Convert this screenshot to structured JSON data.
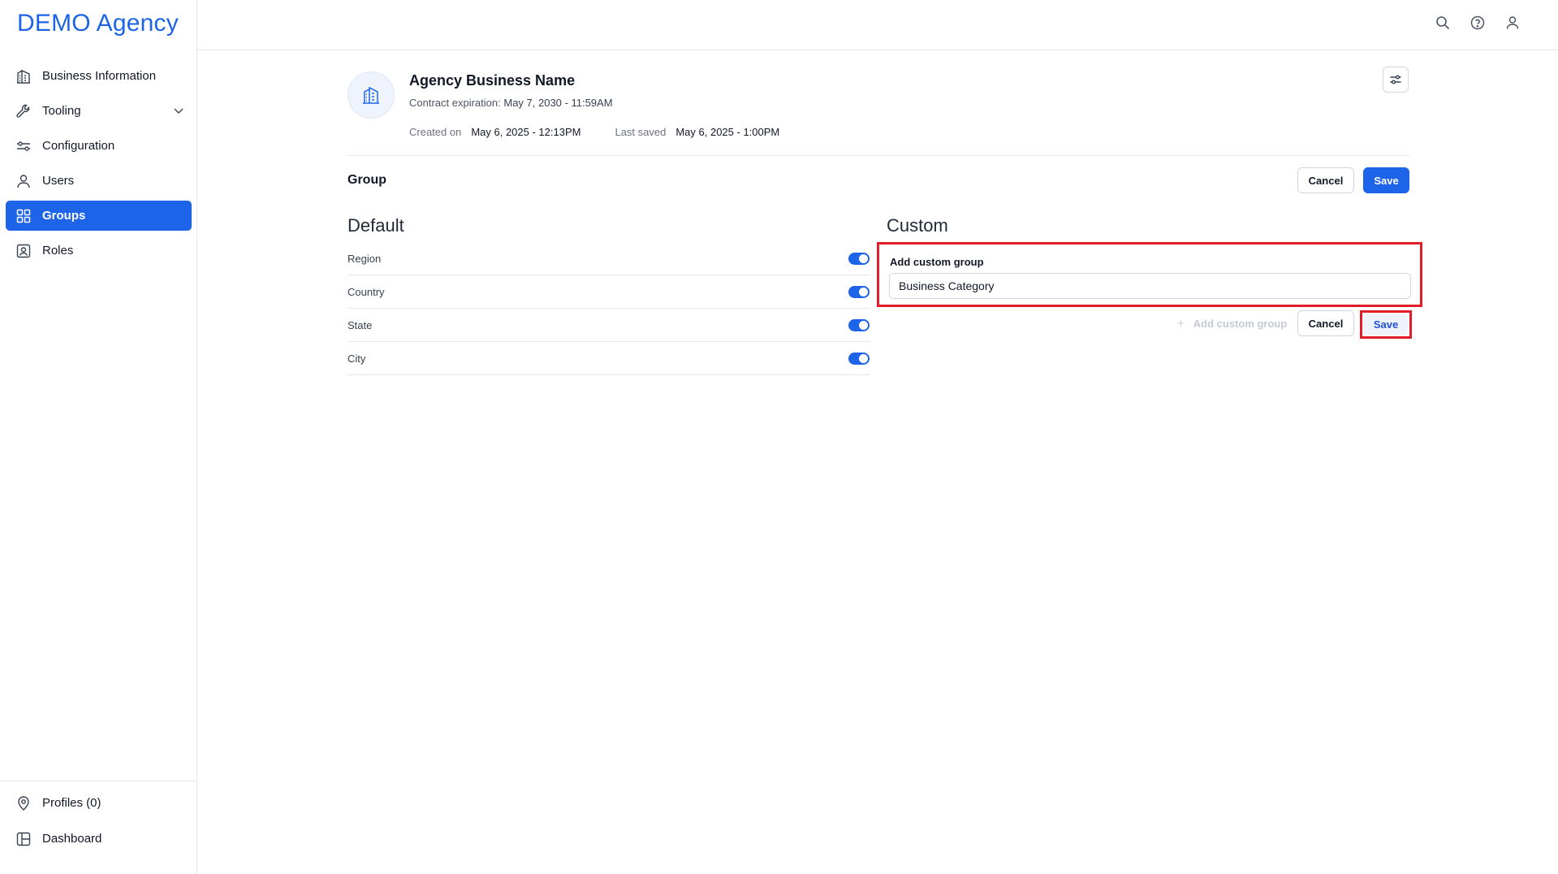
{
  "brand": "DEMO Agency",
  "sidebar": {
    "items": [
      {
        "label": "Business Information",
        "icon": "building-icon"
      },
      {
        "label": "Tooling",
        "icon": "wrench-icon"
      },
      {
        "label": "Configuration",
        "icon": "sliders-icon"
      },
      {
        "label": "Users",
        "icon": "user-icon"
      },
      {
        "label": "Groups",
        "icon": "grid-icon",
        "active": true
      },
      {
        "label": "Roles",
        "icon": "id-badge-icon"
      }
    ],
    "bottom_items": [
      {
        "label": "Profiles (0)",
        "icon": "location-pin-icon"
      },
      {
        "label": "Dashboard",
        "icon": "layout-icon"
      }
    ]
  },
  "agency": {
    "name": "Agency Business Name",
    "contract_label": "Contract expiration:",
    "contract_value": "May 7, 2030 - 11:59AM",
    "created_label": "Created on",
    "created_value": "May 6, 2025 - 12:13PM",
    "saved_label": "Last saved",
    "saved_value": "May 6, 2025 - 1:00PM"
  },
  "group": {
    "title": "Group",
    "cancel_label": "Cancel",
    "save_label": "Save"
  },
  "default_col": {
    "title": "Default",
    "rows": [
      {
        "label": "Region",
        "enabled": true
      },
      {
        "label": "Country",
        "enabled": true
      },
      {
        "label": "State",
        "enabled": true
      },
      {
        "label": "City",
        "enabled": true
      }
    ]
  },
  "custom_col": {
    "title": "Custom",
    "field_label": "Add custom group",
    "field_value": "Business Category",
    "add_label": "Add custom group",
    "cancel_label": "Cancel",
    "save_label": "Save"
  },
  "colors": {
    "accent": "#1d64e8",
    "highlight": "#e11d2a"
  }
}
